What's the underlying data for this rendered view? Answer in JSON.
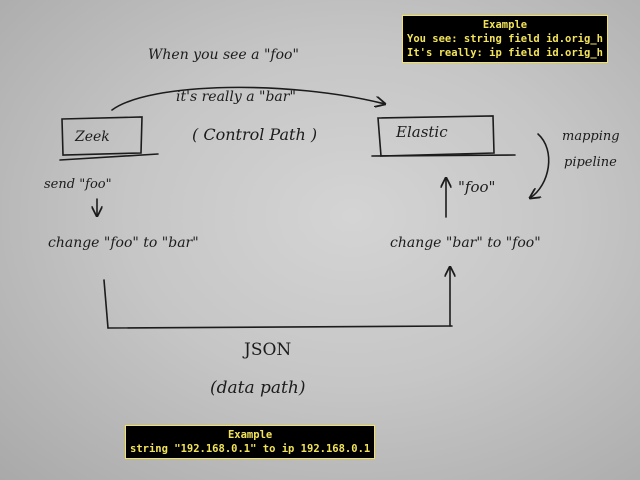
{
  "diagram": {
    "arrow_caption_line1": "When you see a \"foo\"",
    "arrow_caption_line2": "it's really a \"bar\"",
    "control_path": "( Control Path )",
    "zeek_label": "Zeek",
    "elastic_label": "Elastic",
    "mapping_line1": "mapping",
    "mapping_line2": "pipeline",
    "send_foo": "send \"foo\"",
    "change_foo_to_bar": "change \"foo\" to \"bar\"",
    "foo_quoted": "\"foo\"",
    "change_bar_to_foo": "change \"bar\" to \"foo\"",
    "json_label": "JSON",
    "data_path": "(data path)"
  },
  "note_top": {
    "title": "Example",
    "line1": "You see: string field id.orig_h",
    "line2": "It's really: ip field id.orig_h"
  },
  "note_bottom": {
    "title": "Example",
    "line1": "string \"192.168.0.1\" to ip 192.168.0.1"
  },
  "colors": {
    "ink": "#1c1c1c",
    "paper": "#cccccc",
    "note_background": "#000000",
    "note_text": "#f2e35a"
  }
}
